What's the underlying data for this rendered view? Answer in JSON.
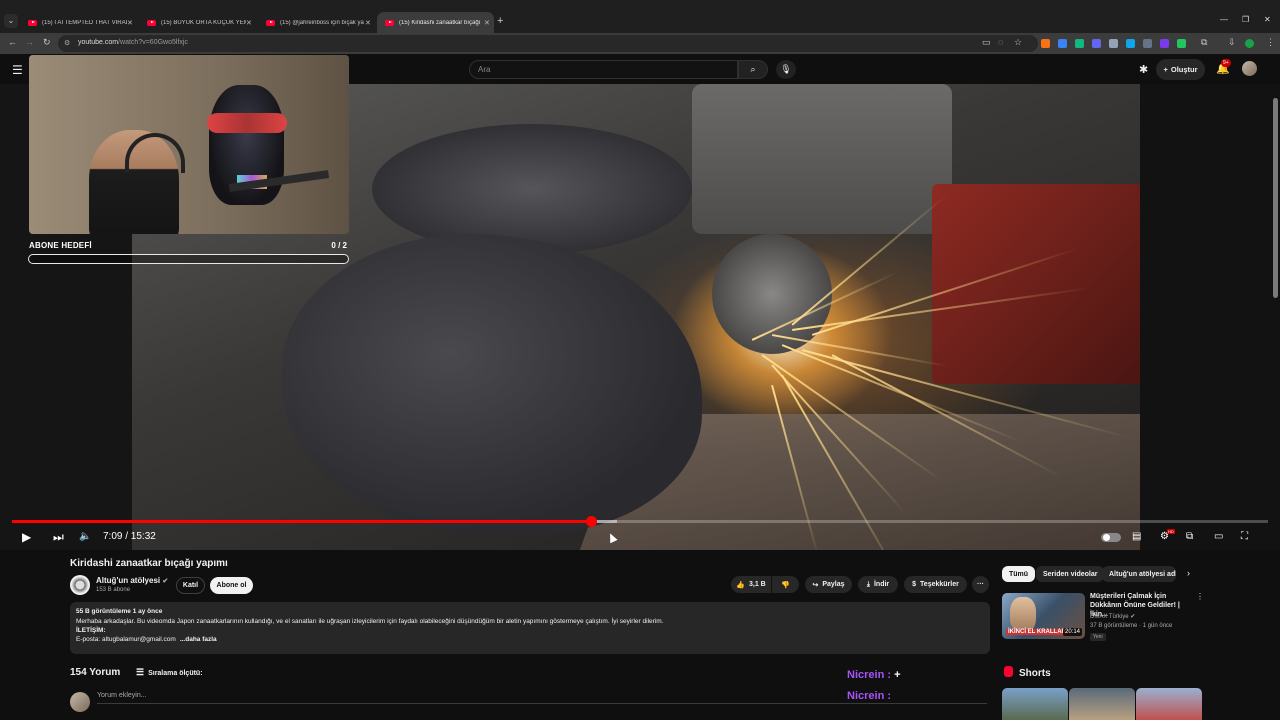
{
  "browser": {
    "tabs": [
      {
        "title": "(15) I ATTEMPTED THAT VIRAL"
      },
      {
        "title": "(15) BÜYÜK ORTA KÜÇÜK YEME"
      },
      {
        "title": "(15) @jahreinboss için bıçak ya"
      },
      {
        "title": "(15) Kiridashi zanaatkar bıçağı"
      }
    ],
    "new_tab": "+",
    "url_domain": "youtube.com",
    "url_path": "/watch?v=60Gwo5lfxjc"
  },
  "header": {
    "search_placeholder": "Ara",
    "create_label": "Oluştur",
    "notif_badge": "9+"
  },
  "overlay": {
    "goal_label": "ABONE HEDEFİ",
    "goal_count": "0  / 2",
    "goal_progress": 0
  },
  "player": {
    "time": "7:09 / 15:32",
    "progress_fraction": 0.461,
    "buffer_fraction": 0.482
  },
  "video": {
    "title": "Kiridashi zanaatkar bıçağı yapımı",
    "channel": "Altuğ'un atölyesi",
    "subscribers": "153 B abone",
    "join_label": "Katıl",
    "subscribe_label": "Abone ol",
    "likes": "3,1 B",
    "share_label": "Paylaş",
    "download_label": "İndir",
    "thanks_label": "Teşekkürler",
    "more_label": "···"
  },
  "description": {
    "stats": "55 B görüntüleme  1 ay önce",
    "line1": "Merhaba arkadaşlar. Bu videomda Japon zanaatkarlarının kullandığı, ve el sanatları ile uğraşan izleyicilerim için faydalı olabileceğini düşündüğüm bir aletin yapımını göstermeye çalıştım. İyi seyirler dilerim.",
    "line2": "İLETİŞİM:",
    "line3": "E-posta: altugbalamur@gmail.com",
    "more": "...daha fazla"
  },
  "comments": {
    "count": "154 Yorum",
    "sort_label": "Sıralama ölçütü:",
    "add_placeholder": "Yorum ekleyin..."
  },
  "overlay_chat": [
    {
      "nick": "Nicrein :",
      "msg": " +"
    },
    {
      "nick": "Nicrein :",
      "msg": ""
    }
  ],
  "sidebar": {
    "chips": [
      "Tümü",
      "Seriden videolar",
      "Altuğ'un atölyesi adlı"
    ],
    "rec": {
      "title": "Müşterileri Çalmak İçin Dükkânın Önüne Geldiler! | İkin...",
      "channel": "DMAX Türkiye",
      "meta": "37 B görüntüleme · 1 gün önce",
      "badge": "Yeni",
      "duration": "20:14",
      "thumb_text": "İKİNCİ EL KRALLARI"
    },
    "shorts_title": "Shorts"
  },
  "colors": {
    "accent_red": "#ff0000",
    "chat_nick": "#a855f7"
  }
}
